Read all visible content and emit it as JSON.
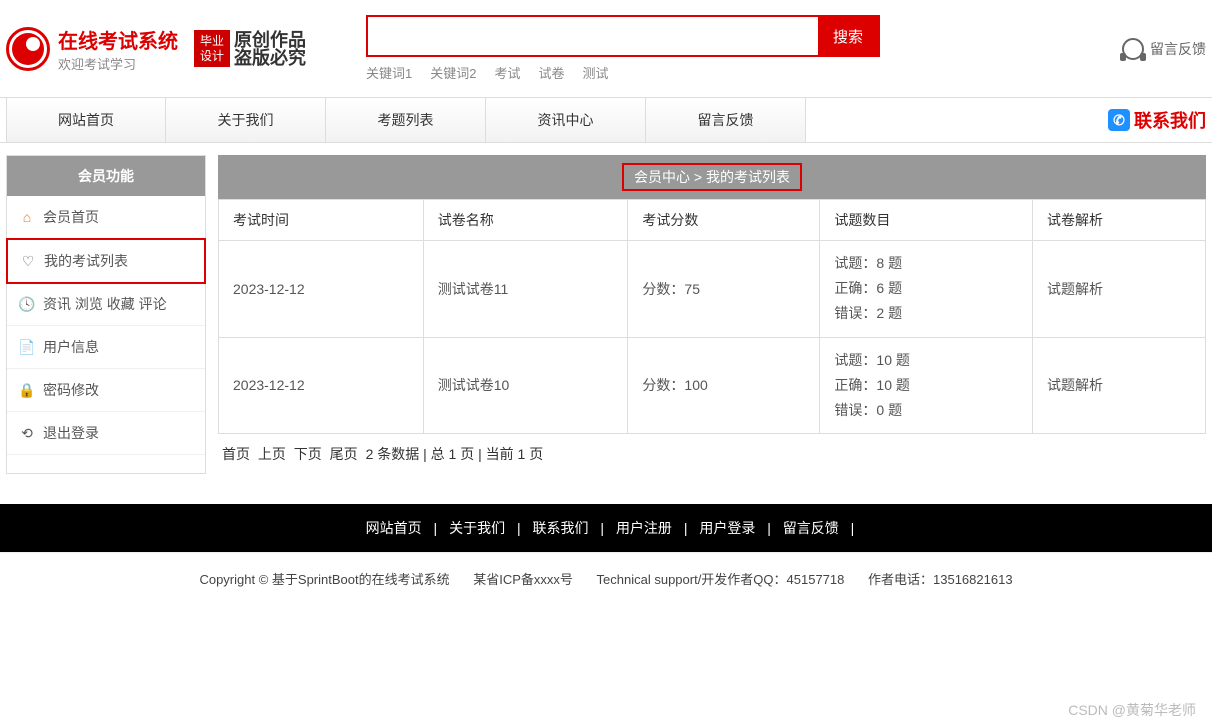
{
  "header": {
    "site_title": "在线考试系统",
    "site_subtitle": "欢迎考试学习",
    "badge1_line1": "毕业",
    "badge1_line2": "设计",
    "badge2_line1": "原创作品",
    "badge2_line2": "盗版必究",
    "search_btn": "搜索",
    "keywords": [
      "关键词1",
      "关键词2",
      "考试",
      "试卷",
      "测试"
    ],
    "feedback": "留言反馈"
  },
  "nav": {
    "items": [
      "网站首页",
      "关于我们",
      "考题列表",
      "资讯中心",
      "留言反馈"
    ],
    "contact": "联系我们"
  },
  "sidebar": {
    "title": "会员功能",
    "items": [
      {
        "icon": "⌂",
        "label": "会员首页",
        "color": "#e67e22"
      },
      {
        "icon": "♡",
        "label": "我的考试列表",
        "color": "#888",
        "active": true
      },
      {
        "icon": "🕓",
        "label": "资讯 浏览 收藏 评论",
        "color": "#888"
      },
      {
        "icon": "📄",
        "label": "用户信息",
        "color": "#3498db"
      },
      {
        "icon": "🔒",
        "label": "密码修改",
        "color": "#e67e22"
      },
      {
        "icon": "⟲",
        "label": "退出登录",
        "color": "#888"
      }
    ]
  },
  "content": {
    "breadcrumb": "会员中心 > 我的考试列表",
    "headers": [
      "考试时间",
      "试卷名称",
      "考试分数",
      "试题数目",
      "试卷解析"
    ],
    "rows": [
      {
        "time": "2023-12-12",
        "name": "测试试卷11",
        "score": "分数：75",
        "stats": {
          "total": "试题：8 题",
          "correct": "正确：6 题",
          "wrong": "错误：2 题"
        },
        "analysis": "试题解析"
      },
      {
        "time": "2023-12-12",
        "name": "测试试卷10",
        "score": "分数：100",
        "stats": {
          "total": "试题：10 题",
          "correct": "正确：10 题",
          "wrong": "错误：0 题"
        },
        "analysis": "试题解析"
      }
    ],
    "pagination": {
      "first": "首页",
      "prev": "上页",
      "next": "下页",
      "last": "尾页",
      "info": "2 条数据 | 总 1 页 | 当前 1 页"
    }
  },
  "footer": {
    "links": [
      "网站首页",
      "关于我们",
      "联系我们",
      "用户注册",
      "用户登录",
      "留言反馈"
    ],
    "copyright": "Copyright © 基于SprintBoot的在线考试系统",
    "icp": "某省ICP备xxxx号",
    "support": "Technical support/开发作者QQ：45157718",
    "phone": "作者电话：13516821613"
  },
  "watermark": "CSDN @黄菊华老师"
}
